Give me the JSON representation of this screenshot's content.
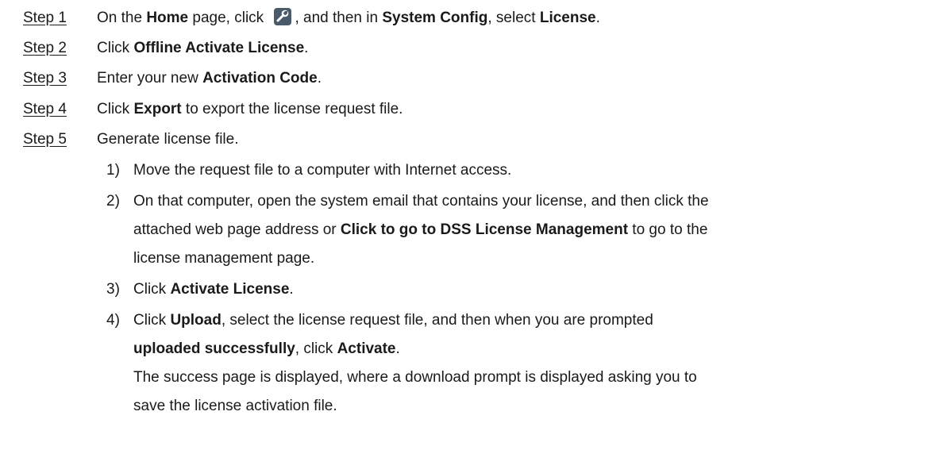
{
  "steps": [
    {
      "label": "Step 1",
      "t1": "On the ",
      "b1": "Home",
      "t2": " page, click ",
      "icon": "settings-tool-icon",
      "t3": ", and then in ",
      "b2": "System Config",
      "t4": ", select ",
      "b3": "License",
      "t5": "."
    },
    {
      "label": "Step 2",
      "t1": "Click ",
      "b1": "Offline Activate License",
      "t2": "."
    },
    {
      "label": "Step 3",
      "t1": "Enter your new ",
      "b1": "Activation Code",
      "t2": "."
    },
    {
      "label": "Step 4",
      "t1": "Click ",
      "b1": "Export",
      "t2": " to export the license request file."
    },
    {
      "label": "Step 5",
      "t1": "Generate license file."
    }
  ],
  "substeps": [
    {
      "num": "1)",
      "t1": "Move the request file to a computer with Internet access."
    },
    {
      "num": "2)",
      "line1": "On that computer, open the system email that contains your license, and then click the",
      "line2_t1": "attached web page address or ",
      "line2_b1": "Click to go to DSS License Management",
      "line2_t2": " to go to the",
      "line3": "license management page."
    },
    {
      "num": "3)",
      "t1": "Click ",
      "b1": "Activate License",
      "t2": "."
    },
    {
      "num": "4)",
      "line1_t1": "Click ",
      "line1_b1": "Upload",
      "line1_t2": ", select the license request file, and then when you are prompted",
      "line2_b1": "uploaded successfully",
      "line2_t1": ", click ",
      "line2_b2": "Activate",
      "line2_t2": ".",
      "result_line1": "The success page is displayed, where a download prompt is displayed asking you to",
      "result_line2": "save the license activation file."
    }
  ],
  "colors": {
    "text": "#1a1a1a",
    "icon_bg": "#4a5a6a"
  }
}
